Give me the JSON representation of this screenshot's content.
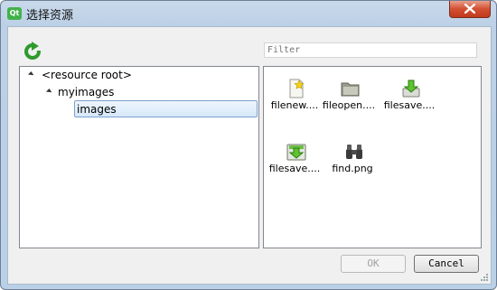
{
  "window": {
    "title": "选择资源"
  },
  "toolbar": {
    "refresh_icon": "refresh-icon"
  },
  "filter": {
    "placeholder": "Filter",
    "value": ""
  },
  "tree": {
    "items": [
      {
        "label": "<resource root>",
        "level": 0,
        "expanded": true
      },
      {
        "label": "myimages",
        "level": 1,
        "expanded": true
      },
      {
        "label": "images",
        "level": 2,
        "selected": true
      }
    ]
  },
  "resources": [
    {
      "label": "filenew....",
      "icon": "new-file-star-icon"
    },
    {
      "label": "fileopen....",
      "icon": "folder-open-icon"
    },
    {
      "label": "filesave....",
      "icon": "save-download-icon"
    },
    {
      "label": "filesave....",
      "icon": "save-green-icon"
    },
    {
      "label": "find.png",
      "icon": "binoculars-icon"
    }
  ],
  "buttons": {
    "ok": "OK",
    "cancel": "Cancel"
  },
  "colors": {
    "accent_green": "#41b24b",
    "close_red": "#c03a1d",
    "selection": "#d6e8fb"
  }
}
